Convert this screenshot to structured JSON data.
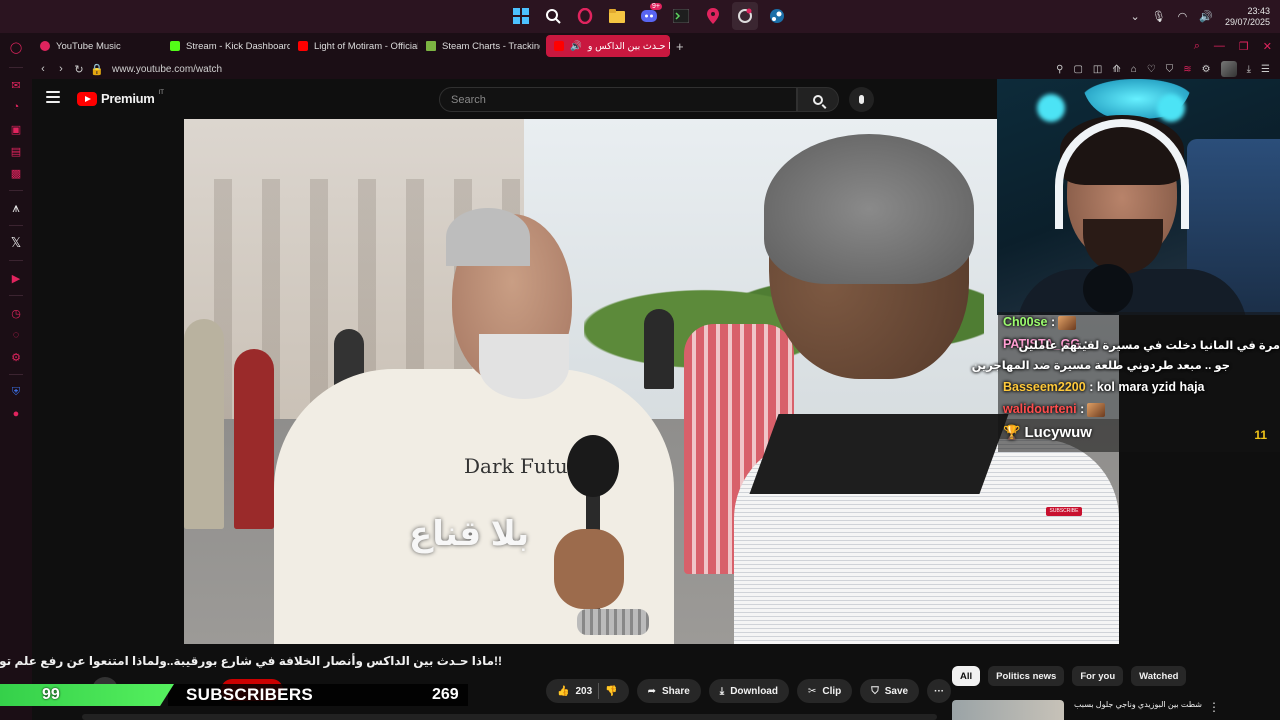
{
  "taskbar": {
    "apps": [
      "windows-start",
      "search",
      "opera-gx",
      "file-explorer",
      "discord",
      "terminal",
      "maps-pin",
      "opera-gx-active",
      "steam"
    ],
    "discord_badge": "9+",
    "clock_time": "23:43",
    "clock_date": "29/07/2025"
  },
  "tabs": [
    {
      "label": "YouTube Music",
      "color": "#e0245e"
    },
    {
      "label": "Stream - Kick Dashboard",
      "color": "#53fc18"
    },
    {
      "label": "Light of Motiram - Official",
      "color": "#ff0000"
    },
    {
      "label": "Steam Charts - Tracking",
      "color": "#7cb342"
    },
    {
      "label": "ماذا حـدث بين الداكس و",
      "color": "#ff0000",
      "active": true
    }
  ],
  "address": {
    "url": "www.youtube.com/watch"
  },
  "youtube": {
    "logo_text": "Premium",
    "country": "IT",
    "search_placeholder": "Search"
  },
  "video": {
    "shirt_text": "Dark Futu",
    "caption": "بلا قناع",
    "watermark": "SUBSCRIBE"
  },
  "chat": {
    "messages": [
      {
        "user": "Ch00se",
        "color": "#9cfc6f",
        "text": ""
      },
      {
        "user": "PATISTA_GG",
        "color": "#ff9ed2",
        "text": ""
      },
      {
        "user": "Basseem2200",
        "color": "#ffc93b",
        "text": "kol mara yzid haja"
      },
      {
        "user": "walidourteni",
        "color": "#ff4d4d",
        "text": ""
      }
    ],
    "rtl_line1": "مرة في المانيا دخلت في مسيرة لقيتهم عاملين",
    "rtl_line2": "جو .. مبعد طردوني طلعة مسيرة ضد المهاجرين",
    "top_user": "Lucywuw",
    "top_count": "11"
  },
  "video_title": "!!ماذا حـدث بين الداكس وأنصار الخلافة في شارع بورقيبة..ولماذا امتنعوا عن رفع علم تونس؟",
  "actions": {
    "likes": "203",
    "share": "Share",
    "download": "Download",
    "clip": "Clip",
    "save": "Save"
  },
  "chips": [
    "All",
    "Politics news",
    "For you",
    "Watched"
  ],
  "recommendation": {
    "title": "شطت بين البوزيدي وناجي جلول بسبب"
  },
  "sub_goal": {
    "current": "99",
    "label": "SUBSCRIBERS",
    "goal": "269",
    "progress": 0.37
  }
}
